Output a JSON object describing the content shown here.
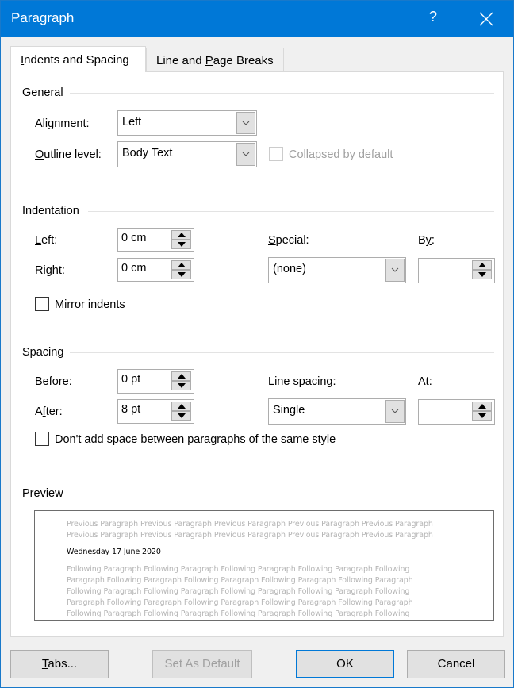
{
  "window": {
    "title": "Paragraph",
    "help_label": "?",
    "close_icon": "close-icon"
  },
  "tabs": [
    {
      "label_prefix": "",
      "label_mnemonic": "I",
      "label_suffix": "ndents and Spacing",
      "active": true
    },
    {
      "label_prefix": "Line and ",
      "label_mnemonic": "P",
      "label_suffix": "age Breaks",
      "active": false
    }
  ],
  "general": {
    "title": "General",
    "alignment_label_pre": "Ali",
    "alignment_label_mn": "g",
    "alignment_label_post": "nment:",
    "alignment_value": "Left",
    "outline_label_mn": "O",
    "outline_label_post": "utline level:",
    "outline_value": "Body Text",
    "collapsed_label": "Collapsed by default",
    "collapsed_checked": false,
    "collapsed_enabled": false
  },
  "indentation": {
    "title": "Indentation",
    "left_label_mn": "L",
    "left_label_post": "eft:",
    "left_value": "0 cm",
    "right_label_mn": "R",
    "right_label_post": "ight:",
    "right_value": "0 cm",
    "special_label_mn": "S",
    "special_label_post": "pecial:",
    "special_value": "(none)",
    "by_label_pre": "B",
    "by_label_mn": "y",
    "by_label_post": ":",
    "by_value": "",
    "mirror_label_mn": "M",
    "mirror_label_post": "irror indents",
    "mirror_checked": false
  },
  "spacing": {
    "title": "Spacing",
    "before_label_mn": "B",
    "before_label_post": "efore:",
    "before_value": "0 pt",
    "after_label_pre": "A",
    "after_label_mn": "f",
    "after_label_post": "ter:",
    "after_value": "8 pt",
    "line_spacing_label_pre": "Li",
    "line_spacing_label_mn": "n",
    "line_spacing_label_post": "e spacing:",
    "line_spacing_value": "Single",
    "at_label_mn": "A",
    "at_label_post": "t:",
    "at_value": "",
    "dont_add_label_pre": "Don't add spa",
    "dont_add_label_mn": "c",
    "dont_add_label_post": "e between paragraphs of the same style",
    "dont_add_checked": false
  },
  "preview": {
    "title": "Preview",
    "previous_lines": [
      "Previous Paragraph Previous Paragraph Previous Paragraph Previous Paragraph Previous Paragraph",
      "Previous Paragraph Previous Paragraph Previous Paragraph Previous Paragraph Previous Paragraph"
    ],
    "current_line": "Wednesday 17 June 2020",
    "following_lines": [
      "Following Paragraph Following Paragraph Following Paragraph Following Paragraph Following",
      "Paragraph Following Paragraph Following Paragraph Following Paragraph Following Paragraph",
      "Following Paragraph Following Paragraph Following Paragraph Following Paragraph Following",
      "Paragraph Following Paragraph Following Paragraph Following Paragraph Following Paragraph",
      "Following Paragraph Following Paragraph Following Paragraph Following Paragraph Following"
    ]
  },
  "buttons": {
    "tabs_mn": "T",
    "tabs_post": "abs...",
    "set_default": "Set As Default",
    "ok": "OK",
    "cancel": "Cancel"
  },
  "colors": {
    "titlebar": "#0078d7",
    "default_button_border": "#0078d7"
  }
}
